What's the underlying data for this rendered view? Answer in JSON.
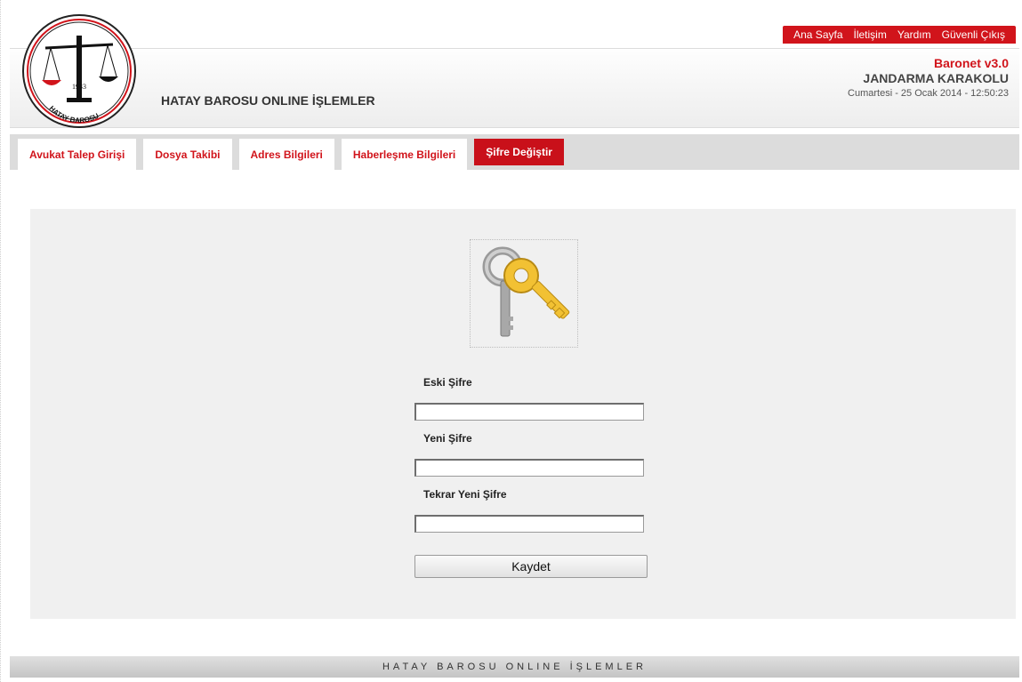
{
  "top_nav": {
    "items": [
      "Ana Sayfa",
      "İletişim",
      "Yardım",
      "Güvenli Çıkış"
    ]
  },
  "logo": {
    "year": "1943",
    "ring_text": "HATAY BAROSU"
  },
  "header": {
    "title": "HATAY BAROSU ONLINE İŞLEMLER",
    "version": "Baronet v3.0",
    "user": "JANDARMA KARAKOLU",
    "datetime": "Cumartesi - 25 Ocak 2014 - 12:50:23"
  },
  "tabs": [
    {
      "label": "Avukat Talep Girişi",
      "active": false
    },
    {
      "label": "Dosya Takibi",
      "active": false
    },
    {
      "label": "Adres Bilgileri",
      "active": false
    },
    {
      "label": "Haberleşme Bilgileri",
      "active": false
    },
    {
      "label": "Şifre Değiştir",
      "active": true
    }
  ],
  "form": {
    "old_password_label": "Eski Şifre",
    "old_password_value": "",
    "new_password_label": "Yeni Şifre",
    "new_password_value": "",
    "repeat_password_label": "Tekrar Yeni Şifre",
    "repeat_password_value": "",
    "save_label": "Kaydet"
  },
  "footer": {
    "text": "HATAY BAROSU ONLINE İŞLEMLER"
  },
  "colors": {
    "accent": "#d1141b",
    "panel": "#f0f0f0"
  }
}
